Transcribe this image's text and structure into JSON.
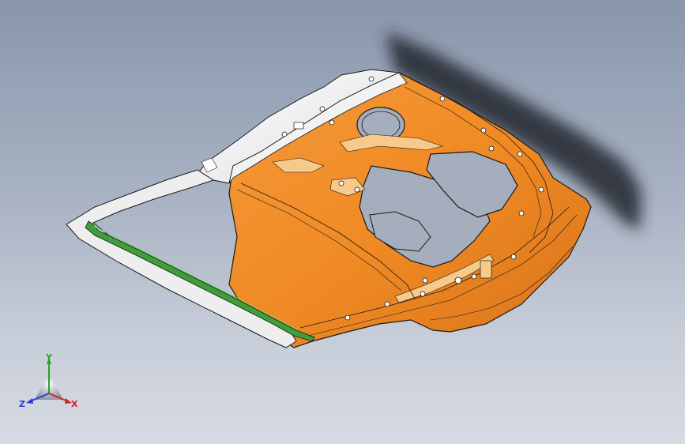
{
  "viewport": {
    "background_top": "#8996ab",
    "background_bottom": "#d5dae3"
  },
  "model": {
    "part_color": "#f08a24",
    "part_highlight": "#f7c98a",
    "gray_region_color": "#eeeeef",
    "seal_color": "#3f9e3a",
    "edge_color": "#1a1a1a",
    "shadow_color": "#2a2e36"
  },
  "triad": {
    "x_label": "X",
    "y_label": "Y",
    "z_label": "Z",
    "x_color": "#d42323",
    "y_color": "#2ba02b",
    "z_color": "#2a3fd1"
  }
}
